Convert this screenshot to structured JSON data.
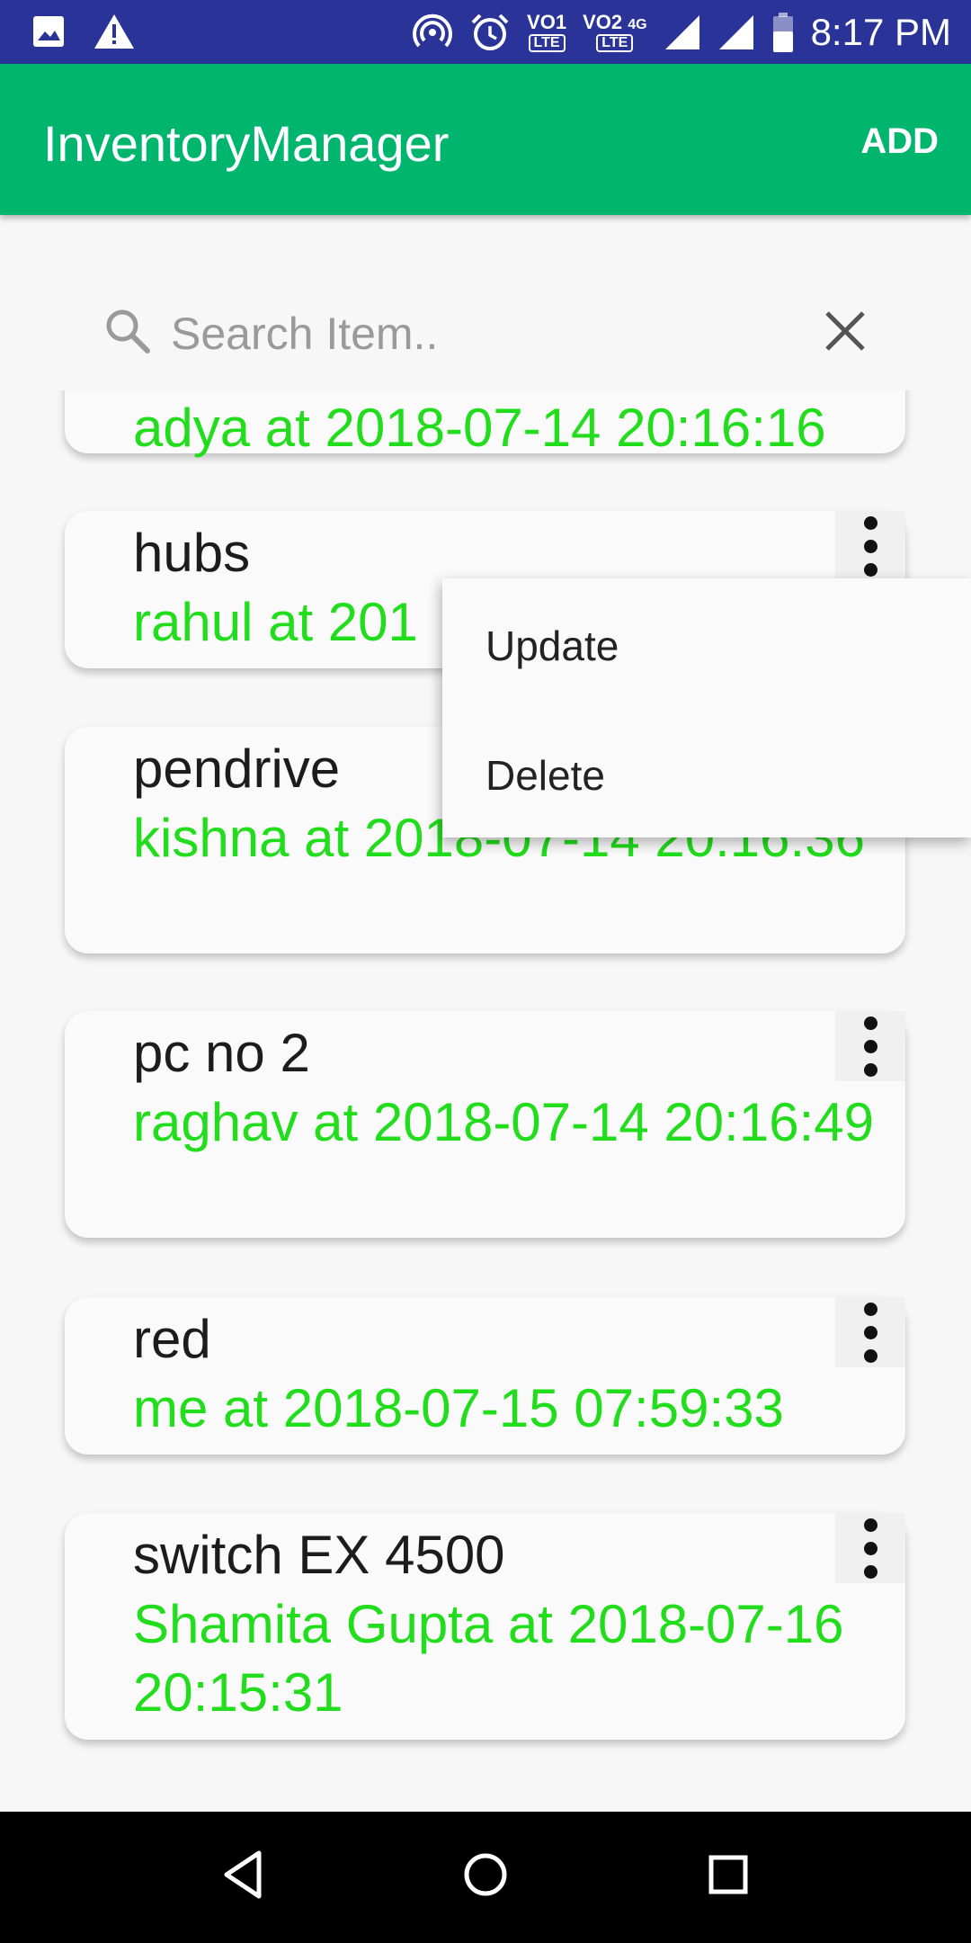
{
  "status_bar": {
    "time": "8:17 PM",
    "sim1": {
      "label": "VO",
      "num": "1",
      "type": "LTE"
    },
    "sim2": {
      "label": "VO",
      "num": "2",
      "type": "LTE",
      "network": "4G"
    },
    "icons": [
      "image-icon",
      "warning-icon",
      "hotspot-icon",
      "alarm-icon",
      "signal-icon",
      "signal-icon",
      "battery-icon"
    ]
  },
  "app_bar": {
    "title": "InventoryManager",
    "add_label": "ADD",
    "color": "#00b56e"
  },
  "search": {
    "placeholder": "Search Item.."
  },
  "items": [
    {
      "title": "",
      "subtitle": "adya at 2018-07-14 20:16:16"
    },
    {
      "title": "hubs",
      "subtitle": "rahul at 201"
    },
    {
      "title": "pendrive",
      "subtitle": "kishna at 2018-07-14 20:16:36"
    },
    {
      "title": "pc no 2",
      "subtitle": "raghav at 2018-07-14 20:16:49"
    },
    {
      "title": "red",
      "subtitle": "me at 2018-07-15 07:59:33"
    },
    {
      "title": "switch EX 4500",
      "subtitle": "Shamita Gupta at 2018-07-16 20:15:31"
    }
  ],
  "menu": {
    "update": "Update",
    "delete": "Delete"
  },
  "colors": {
    "subtitle": "#22dd1c",
    "status_bar": "#2a3398"
  }
}
